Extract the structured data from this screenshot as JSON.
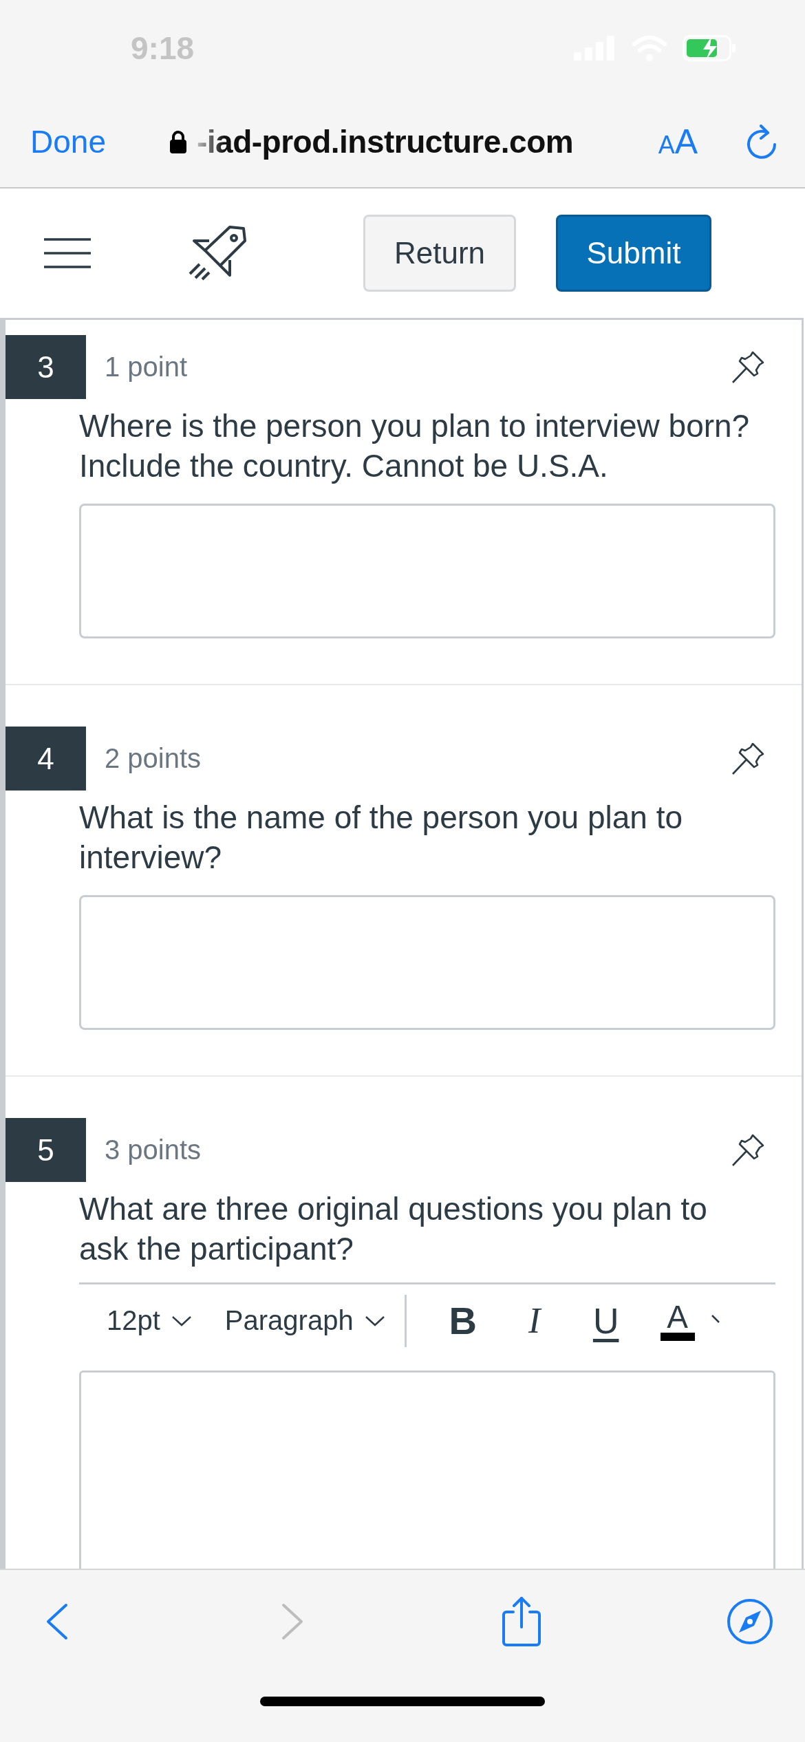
{
  "status_bar": {
    "time": "9:18"
  },
  "browser": {
    "done": "Done",
    "url": "-iad-prod.instructure.com",
    "text_size": "AA",
    "back_enabled": true,
    "forward_enabled": false
  },
  "toolbar": {
    "buttons": [
      {
        "label": "Return",
        "kind": "secondary"
      },
      {
        "label": "Submit",
        "kind": "primary"
      }
    ]
  },
  "questions": [
    {
      "number": "3",
      "points": "1 point",
      "text": "Where is the person you plan to interview born? Include the country.  Cannot be U.S.A.",
      "kind": "text"
    },
    {
      "number": "4",
      "points": "2 points",
      "text": "What is the name of the person you plan to interview?",
      "kind": "text"
    },
    {
      "number": "5",
      "points": "3 points",
      "text": "What are three original questions you plan to ask the participant?",
      "kind": "rich",
      "editor": {
        "font_size": "12pt",
        "block_format": "Paragraph",
        "format_buttons": [
          {
            "label": "B",
            "kind": "bold"
          },
          {
            "label": "I",
            "kind": "italic"
          },
          {
            "label": "U",
            "kind": "underline"
          },
          {
            "label": "A",
            "kind": "text_color"
          }
        ]
      }
    }
  ]
}
